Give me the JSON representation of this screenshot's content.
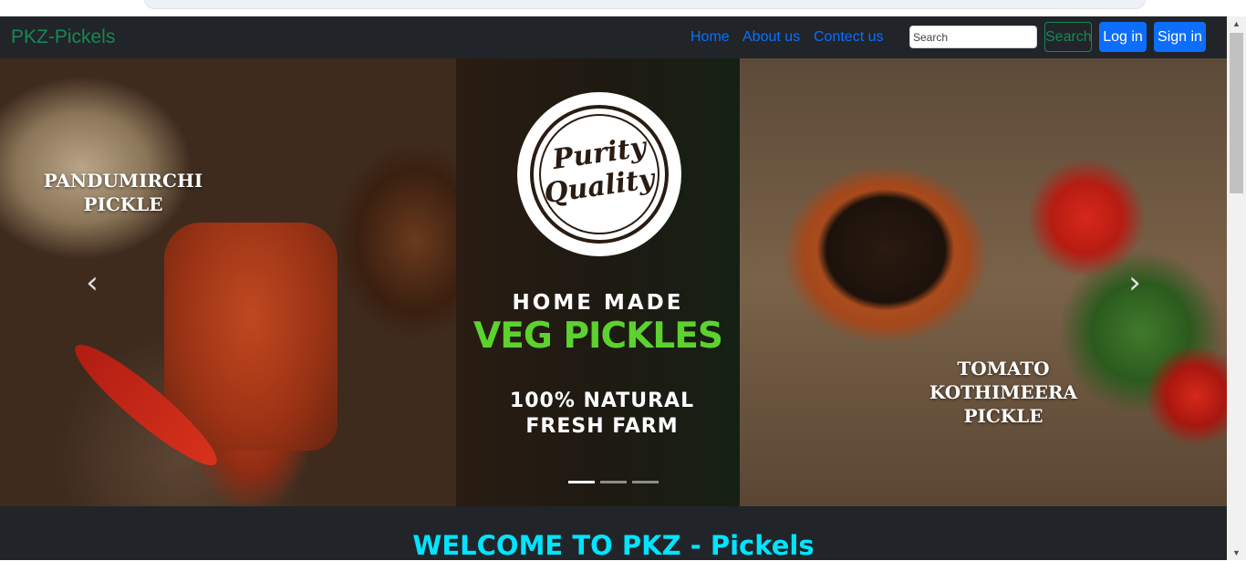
{
  "navbar": {
    "brand": "PKZ-Pickels",
    "links": [
      "Home",
      "About us",
      "Contect us"
    ],
    "search_placeholder": "Search",
    "search_button": "Search",
    "login_button": "Log in",
    "signin_button": "Sign in"
  },
  "carousel": {
    "left_label": "PANDUMIRCHI PICKLE",
    "right_label": "TOMATO KOTHIMEERA PICKLE",
    "badge_line1": "Purity",
    "badge_line2": "Quality",
    "home_made": "HOME MADE",
    "veg_pickles": "VEG PICKLES",
    "natural": "100% NATURAL FRESH FARM",
    "prev_icon": "chevron-left-icon",
    "next_icon": "chevron-right-icon",
    "slides": 3,
    "active_slide": 1
  },
  "welcome": "WELCOME TO PKZ - Pickels",
  "colors": {
    "navbar_bg": "#212529",
    "brand": "#198754",
    "link": "#0d6efd",
    "veg_green": "#5cd22e",
    "welcome_cyan": "#00e5ff"
  }
}
